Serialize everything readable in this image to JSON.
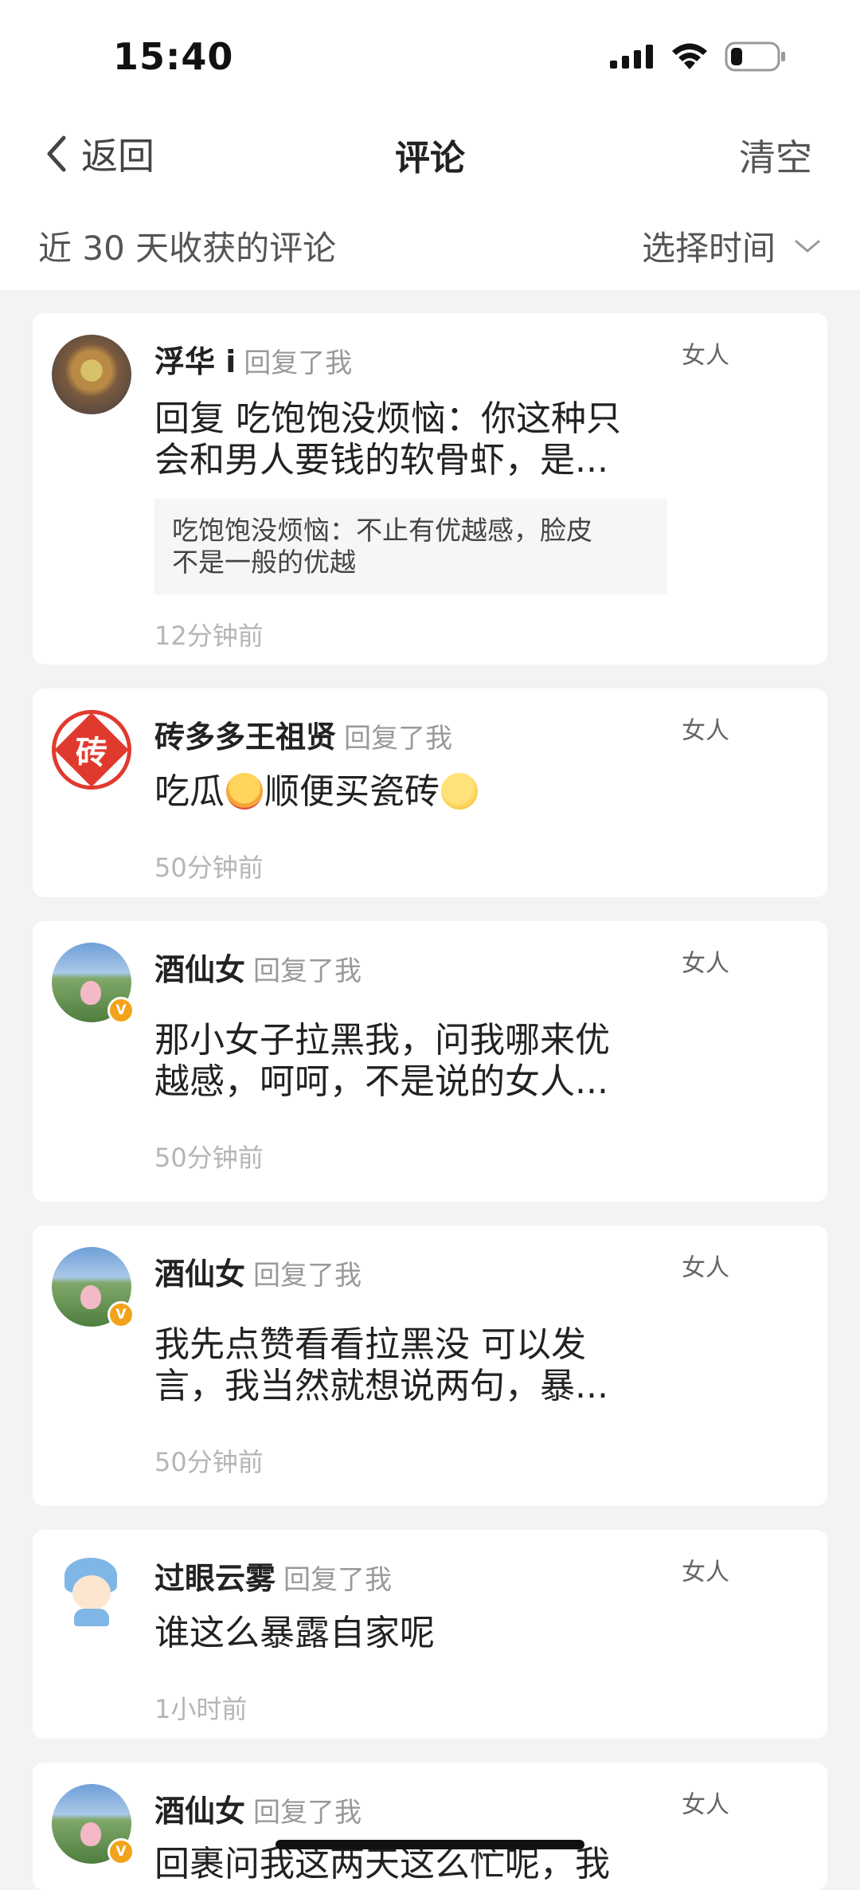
{
  "status_bar": {
    "time": "15:40"
  },
  "nav": {
    "back_label": "返回",
    "title": "评论",
    "clear_label": "清空"
  },
  "filter": {
    "range_label": "近 30 天收获的评论",
    "time_select_label": "选择时间"
  },
  "comments": [
    {
      "user": "浮华 i",
      "action": "回复了我",
      "tag": "女人",
      "text_line1": "回复 吃饱饱没烦恼：你这种只",
      "text_line2": "会和男人要钱的软骨虾，是...",
      "quote_line1": "吃饱饱没烦恼：不止有优越感，脸皮",
      "quote_line2": "不是一般的优越",
      "time": "12分钟前"
    },
    {
      "user": "砖多多王祖贤",
      "action": "回复了我",
      "tag": "女人",
      "avatar_char": "砖",
      "text_part1": "吃瓜",
      "text_part2": "顺便买瓷砖",
      "time": "50分钟前"
    },
    {
      "user": "酒仙女",
      "action": "回复了我",
      "tag": "女人",
      "text_line1": "那小女子拉黑我，问我哪来优",
      "text_line2": "越感，呵呵，不是说的女人...",
      "time": "50分钟前"
    },
    {
      "user": "酒仙女",
      "action": "回复了我",
      "tag": "女人",
      "text_line1": "我先点赞看看拉黑没 可以发",
      "text_line2": "言，我当然就想说两句，暴...",
      "time": "50分钟前"
    },
    {
      "user": "过眼云雾",
      "action": "回复了我",
      "tag": "女人",
      "text_line1": "谁这么暴露自家呢",
      "time": "1小时前"
    },
    {
      "user": "酒仙女",
      "action": "回复了我",
      "tag": "女人",
      "text_line1": "回裹问我这两天这么忙呢，我"
    }
  ],
  "badge_glyph": "V",
  "colors": {
    "avatar_brick": "#e03a2f",
    "badge": "#f2a31b",
    "time_gray": "#b5b5b5"
  }
}
